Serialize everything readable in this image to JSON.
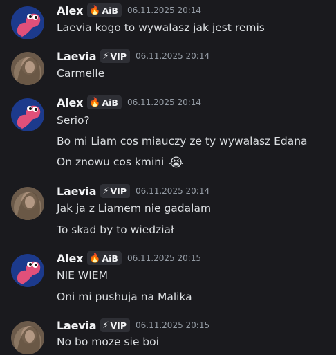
{
  "users": {
    "alex": {
      "name": "Alex",
      "tag_icon": "fire-icon",
      "tag_glyph": "🔥",
      "tag_label": "AiB",
      "avatar": "pink-blob-avatar"
    },
    "laevia": {
      "name": "Laevia",
      "tag_icon": "lightning-icon",
      "tag_glyph": "⚡",
      "tag_label": "VIP",
      "avatar": "photo-avatar"
    }
  },
  "messages": [
    {
      "author": "Alex",
      "tag_icon": "🔥",
      "tag_label": "AiB",
      "timestamp": "06.11.2025 20:14",
      "lines": [
        "Laevia kogo to wywalasz jak jest remis"
      ]
    },
    {
      "author": "Laevia",
      "tag_icon": "⚡",
      "tag_label": "VIP",
      "timestamp": "06.11.2025 20:14",
      "lines": [
        "Carmelle"
      ]
    },
    {
      "author": "Alex",
      "tag_icon": "🔥",
      "tag_label": "AiB",
      "timestamp": "06.11.2025 20:14",
      "lines": [
        "Serio?",
        "Bo mi Liam cos miauczy ze ty wywalasz Edana",
        "On znowu cos kmini"
      ],
      "emoji": "😭"
    },
    {
      "author": "Laevia",
      "tag_icon": "⚡",
      "tag_label": "VIP",
      "timestamp": "06.11.2025 20:14",
      "lines": [
        "Jak ja z Liamem nie gadalam",
        "To skad by to wiedział"
      ]
    },
    {
      "author": "Alex",
      "tag_icon": "🔥",
      "tag_label": "AiB",
      "timestamp": "06.11.2025 20:15",
      "lines": [
        "NIE WIEM",
        "Oni mi pushuja na Malika"
      ]
    },
    {
      "author": "Laevia",
      "tag_icon": "⚡",
      "tag_label": "VIP",
      "timestamp": "06.11.2025 20:15",
      "lines": [
        "No bo moze sie boi"
      ]
    }
  ],
  "colors": {
    "background": "#1a1a1e",
    "username": "#f2f3f5",
    "text": "#dbdee1",
    "timestamp": "#949ba4",
    "tag_background": "#2e2f35",
    "alex_avatar_bg": "#1c3a8c",
    "alex_avatar_blob": "#e0507a"
  }
}
